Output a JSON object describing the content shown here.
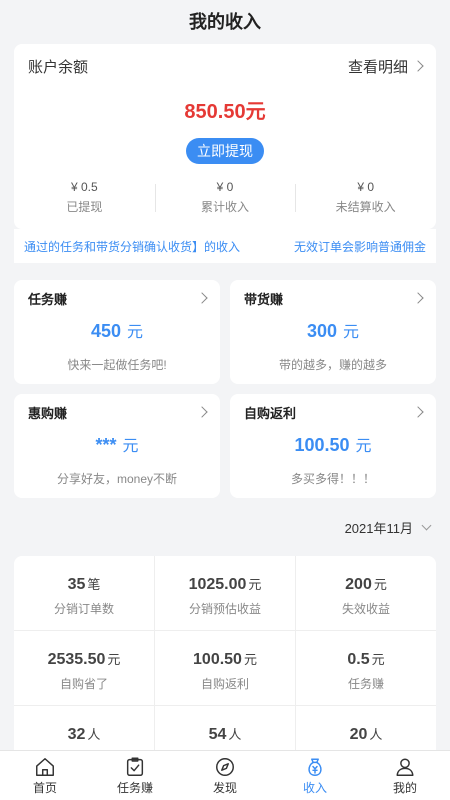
{
  "header": {
    "title": "我的收入"
  },
  "balance": {
    "label": "账户余额",
    "detail_label": "查看明细",
    "amount": "850.50元",
    "withdraw_label": "立即提现",
    "stats": [
      {
        "value": "¥ 0.5",
        "label": "已提现"
      },
      {
        "value": "¥ 0",
        "label": "累计收入"
      },
      {
        "value": "¥ 0",
        "label": "未结算收入"
      }
    ]
  },
  "notice": {
    "left": "通过的任务和带货分销确认收货】的收入",
    "right": "无效订单会影响普通佣金"
  },
  "earn_cards": [
    {
      "title": "任务赚",
      "amount": "450",
      "unit": "元",
      "desc": "快来一起做任务吧!"
    },
    {
      "title": "带货赚",
      "amount": "300",
      "unit": "元",
      "desc": "带的越多，赚的越多"
    },
    {
      "title": "惠购赚",
      "amount": "***",
      "unit": "元",
      "desc": "分享好友，money不断"
    },
    {
      "title": "自购返利",
      "amount": "100.50",
      "unit": "元",
      "desc": "多买多得！！！"
    }
  ],
  "month_selector": {
    "value": "2021年11月"
  },
  "stats_grid": [
    [
      {
        "value": "35",
        "unit": "笔",
        "label": "分销订单数"
      },
      {
        "value": "1025.00",
        "unit": "元",
        "label": "分销预估收益"
      },
      {
        "value": "200",
        "unit": "元",
        "label": "失效收益"
      }
    ],
    [
      {
        "value": "2535.50",
        "unit": "元",
        "label": "自购省了"
      },
      {
        "value": "100.50",
        "unit": "元",
        "label": "自购返利"
      },
      {
        "value": "0.5",
        "unit": "元",
        "label": "任务赚"
      }
    ],
    [
      {
        "value": "32",
        "unit": "人",
        "label": ""
      },
      {
        "value": "54",
        "unit": "人",
        "label": ""
      },
      {
        "value": "20",
        "unit": "人",
        "label": ""
      }
    ]
  ],
  "tabbar": [
    {
      "label": "首页",
      "icon": "home-icon"
    },
    {
      "label": "任务赚",
      "icon": "task-icon"
    },
    {
      "label": "发现",
      "icon": "compass-icon"
    },
    {
      "label": "收入",
      "icon": "income-icon",
      "active": true
    },
    {
      "label": "我的",
      "icon": "user-icon"
    }
  ],
  "colors": {
    "accent": "#3b8df3",
    "amount_red": "#e53935"
  }
}
